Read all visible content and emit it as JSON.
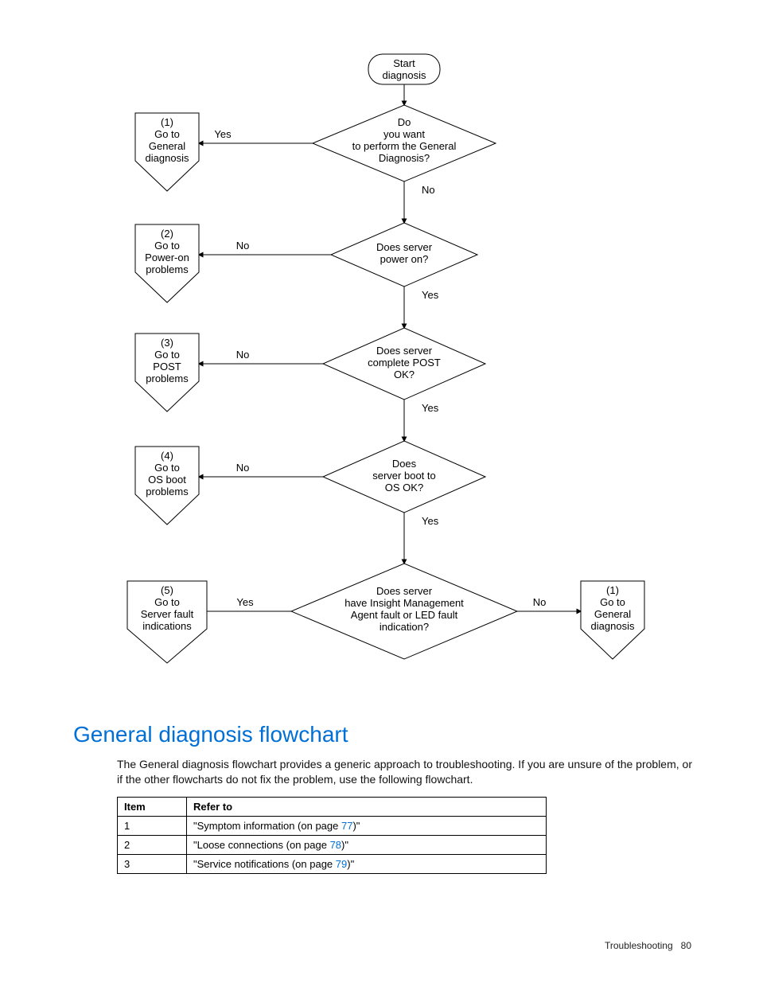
{
  "flow": {
    "start": {
      "l1": "Start",
      "l2": "diagnosis"
    },
    "d1": {
      "l1": "Do",
      "l2": "you want",
      "l3": "to perform the General",
      "l4": "Diagnosis?"
    },
    "d2": {
      "l1": "Does server",
      "l2": "power on?"
    },
    "d3": {
      "l1": "Does server",
      "l2": "complete POST",
      "l3": "OK?"
    },
    "d4": {
      "l1": "Does",
      "l2": "server boot to",
      "l3": "OS OK?"
    },
    "d5": {
      "l1": "Does server",
      "l2": "have Insight Management",
      "l3": "Agent fault or LED fault",
      "l4": "indication?"
    },
    "p1": {
      "n": "(1)",
      "l1": "Go to",
      "l2": "General",
      "l3": "diagnosis"
    },
    "p2": {
      "n": "(2)",
      "l1": "Go to",
      "l2": "Power-on",
      "l3": "problems"
    },
    "p3": {
      "n": "(3)",
      "l1": "Go to",
      "l2": "POST",
      "l3": "problems"
    },
    "p4": {
      "n": "(4)",
      "l1": "Go to",
      "l2": "OS boot",
      "l3": "problems"
    },
    "p5": {
      "n": "(5)",
      "l1": "Go to",
      "l2": "Server fault",
      "l3": "indications"
    },
    "p1b": {
      "n": "(1)",
      "l1": "Go to",
      "l2": "General",
      "l3": "diagnosis"
    },
    "labels": {
      "yes": "Yes",
      "no": "No"
    }
  },
  "heading": "General diagnosis flowchart",
  "paragraph": "The General diagnosis flowchart provides a generic approach to troubleshooting. If you are unsure of the problem, or if the other flowcharts do not fix the problem, use the following flowchart.",
  "table": {
    "h1": "Item",
    "h2": "Refer to",
    "r1a": "1",
    "r1b_pre": "\"Symptom information (on page ",
    "r1b_pg": "77",
    "r1b_post": ")\"",
    "r2a": "2",
    "r2b_pre": "\"Loose connections (on page ",
    "r2b_pg": "78",
    "r2b_post": ")\"",
    "r3a": "3",
    "r3b_pre": "\"Service notifications (on page ",
    "r3b_pg": "79",
    "r3b_post": ")\""
  },
  "footer": {
    "section": "Troubleshooting",
    "page": "80"
  }
}
